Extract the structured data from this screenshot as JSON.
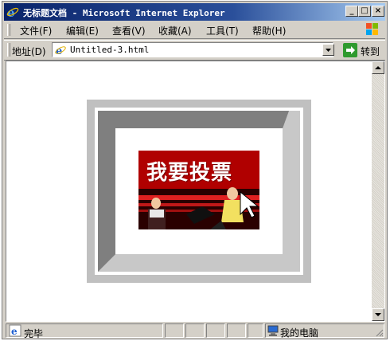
{
  "window": {
    "title": "无标题文档 - Microsoft Internet Explorer",
    "minimize_glyph": "_",
    "maximize_glyph": "□",
    "close_glyph": "×"
  },
  "menu": {
    "items": [
      {
        "label": "文件(F)"
      },
      {
        "label": "编辑(E)"
      },
      {
        "label": "查看(V)"
      },
      {
        "label": "收藏(A)"
      },
      {
        "label": "工具(T)"
      },
      {
        "label": "帮助(H)"
      }
    ]
  },
  "address_bar": {
    "label": "地址(D)",
    "url": "Untitled-3.html",
    "go_label": "转到"
  },
  "content": {
    "banner": {
      "headline": "我要投票"
    }
  },
  "status_bar": {
    "status_text": "完毕",
    "zone_text": "我的电脑"
  },
  "colors": {
    "titlebar": "#0a246a",
    "chrome": "#d4d0c8",
    "frame_outer": "#c0c0c0",
    "frame_inner": "#7f7f7f",
    "banner_red": "#d01010"
  }
}
